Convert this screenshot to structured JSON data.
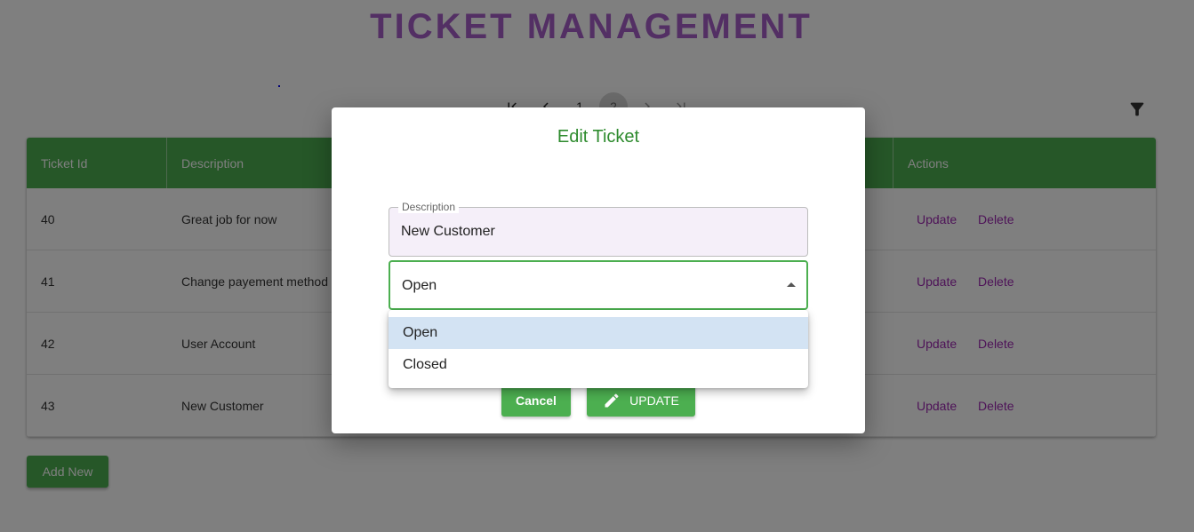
{
  "page": {
    "title": "TICKET MANAGEMENT"
  },
  "pagination": {
    "pages": [
      "1",
      "2"
    ],
    "current_page": "2"
  },
  "table": {
    "columns": [
      "Ticket Id",
      "Description",
      "Actions"
    ],
    "rows": [
      {
        "id": "40",
        "description": "Great job for now"
      },
      {
        "id": "41",
        "description": "Change payement method"
      },
      {
        "id": "42",
        "description": "User Account"
      },
      {
        "id": "43",
        "description": "New Customer"
      }
    ],
    "update_label": "Update",
    "delete_label": "Delete"
  },
  "add_new_label": "Add New",
  "modal": {
    "title": "Edit Ticket",
    "description_label": "Description",
    "description_value": "New Customer",
    "status_value": "Open",
    "status_options": [
      "Open",
      "Closed"
    ],
    "cancel_label": "Cancel",
    "update_label": "UPDATE"
  },
  "colors": {
    "accent_green": "#4caf50",
    "title_purple": "#a65fc8",
    "link_purple": "#9c27b0",
    "modal_title_green": "#2e8b2e",
    "selected_option": "#d3e3f3"
  },
  "icons": [
    "first-page-icon",
    "previous-page-icon",
    "next-page-icon",
    "last-page-icon",
    "filter-icon",
    "pencil-icon",
    "caret-up-icon"
  ]
}
